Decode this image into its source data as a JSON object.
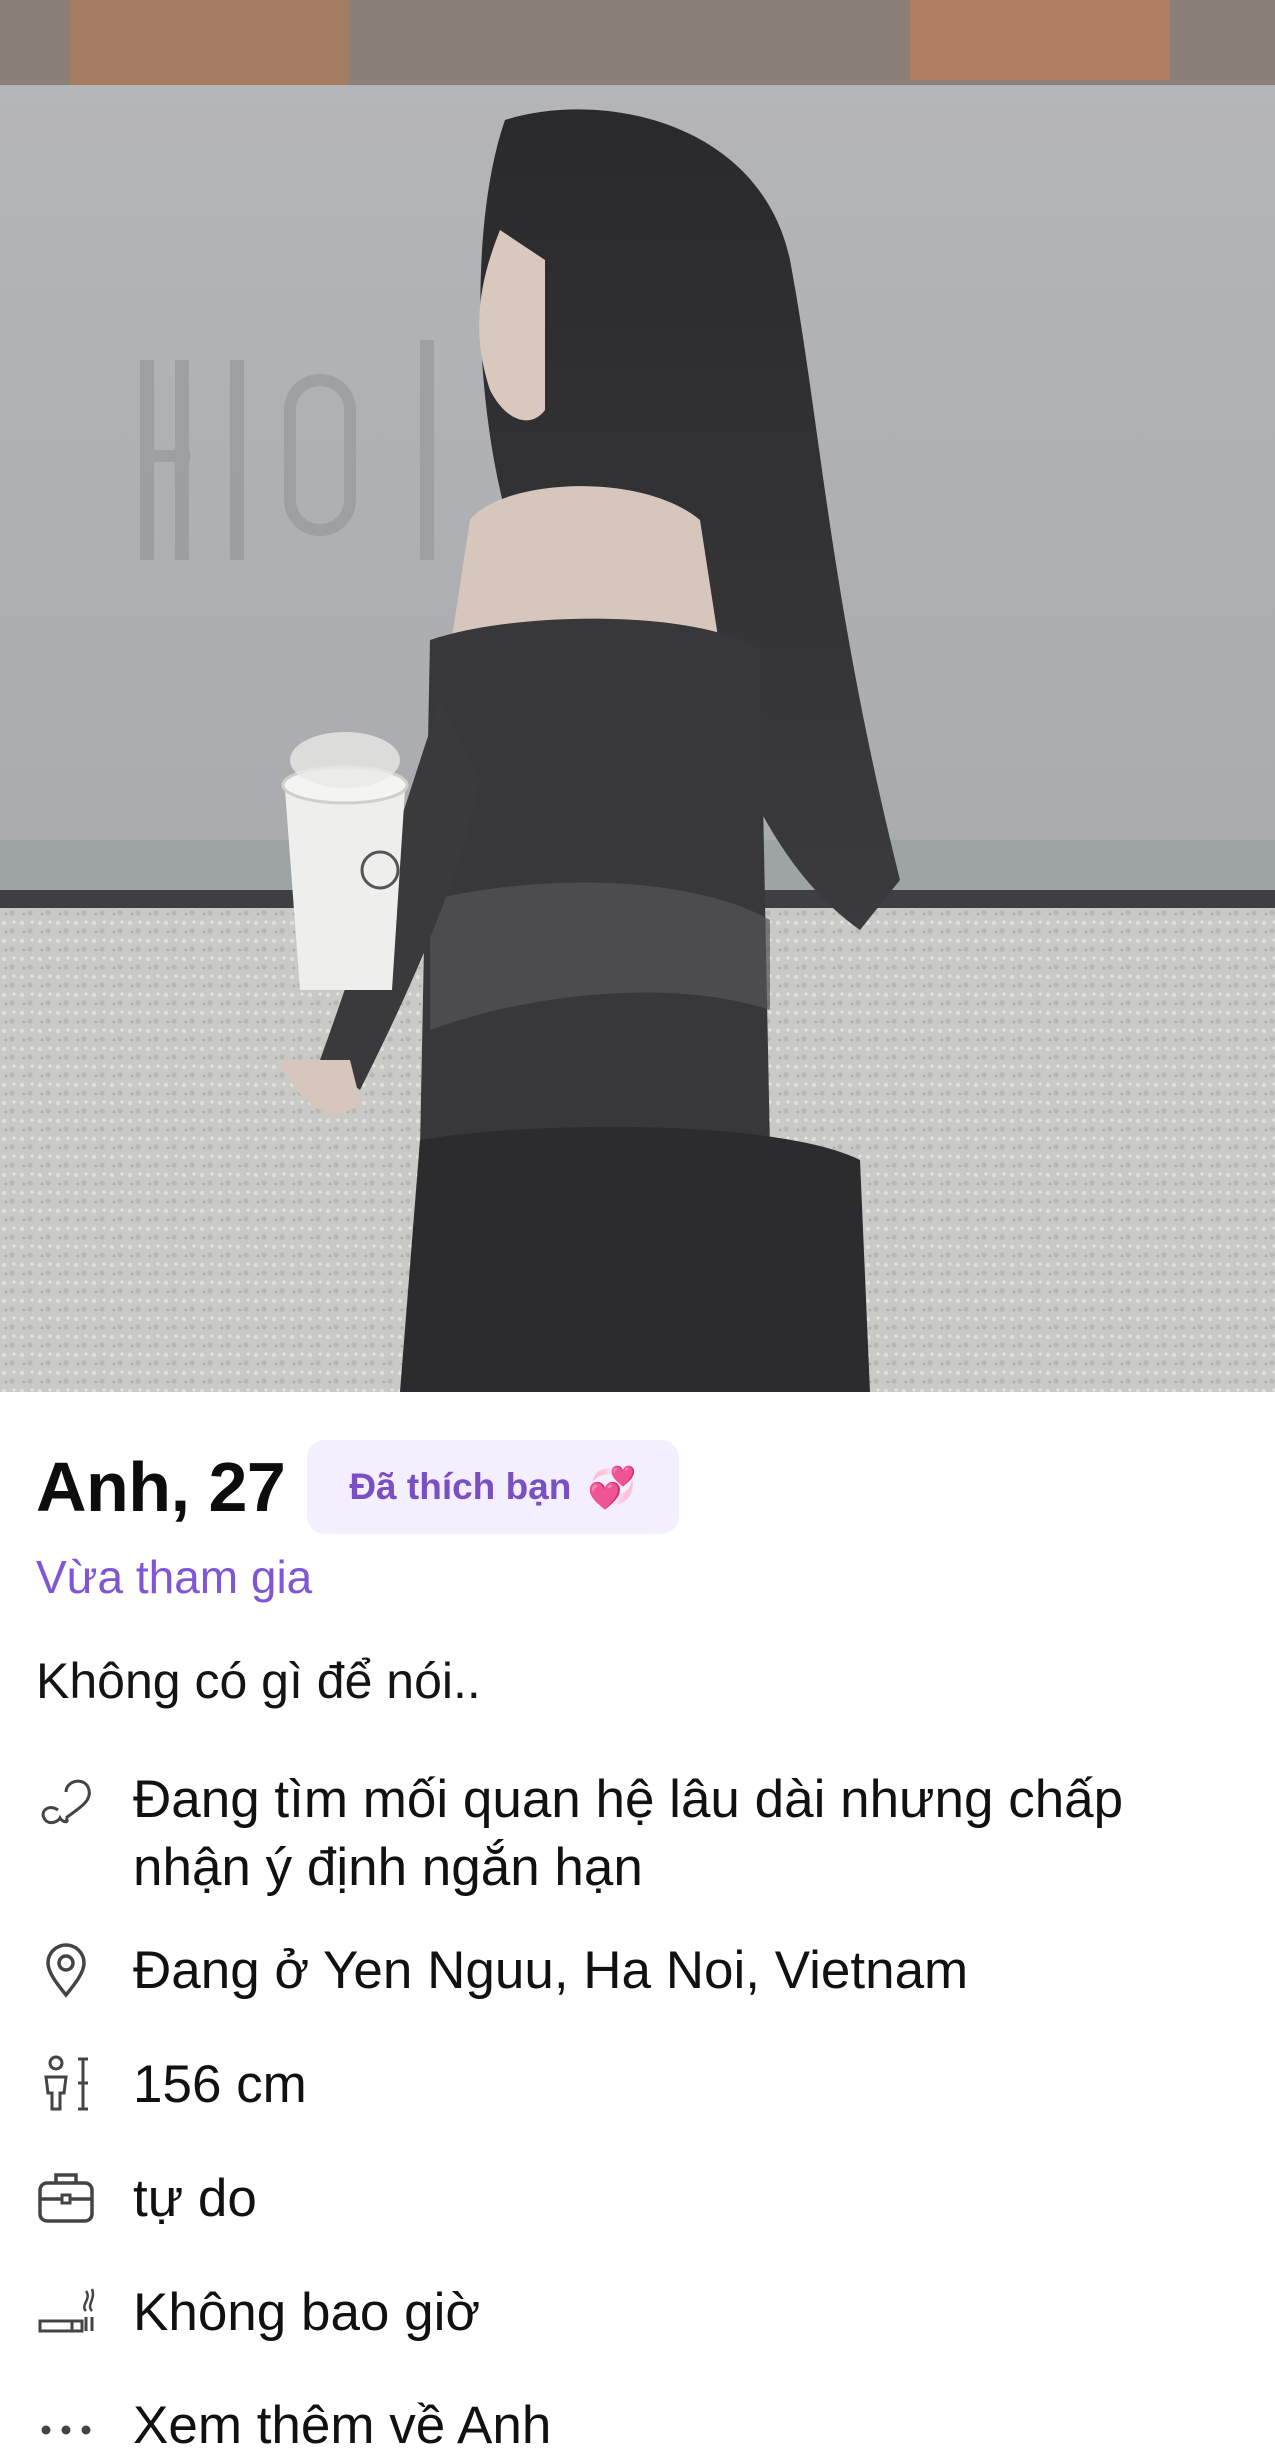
{
  "profile": {
    "name_age": "Anh, 27",
    "badge": "Đã thích bạn",
    "badge_emoji": "💞",
    "joined": "Vừa tham gia",
    "bio": "Không có gì để nói.."
  },
  "details": [
    {
      "icon": "heart-outline-icon",
      "text": "Đang tìm mối quan hệ lâu dài nhưng chấp nhận ý định ngắn hạn"
    },
    {
      "icon": "location-pin-icon",
      "text": "Đang ở Yen Nguu, Ha Noi, Vietnam"
    },
    {
      "icon": "height-icon",
      "text": "156 cm"
    },
    {
      "icon": "briefcase-icon",
      "text": "tự do"
    },
    {
      "icon": "smoking-icon",
      "text": "Không bao giờ"
    },
    {
      "icon": "more-dots-icon",
      "text": "Xem thêm về Anh"
    }
  ],
  "colors": {
    "accent": "#7e56d6",
    "badge_bg": "#f4effe",
    "badge_text": "#7a4fc4"
  }
}
